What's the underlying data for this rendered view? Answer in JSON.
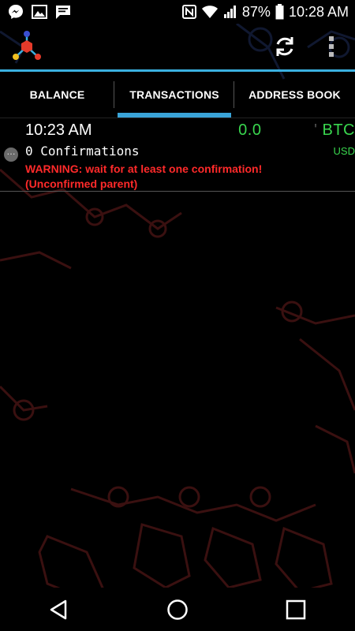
{
  "status_bar": {
    "battery": "87%",
    "time": "10:28 AM",
    "icons": [
      "messenger-icon",
      "image-icon",
      "message-icon",
      "nfc-icon",
      "wifi-icon",
      "signal-icon",
      "battery-icon"
    ]
  },
  "action_bar": {
    "logo": "mycelium-logo-icon",
    "refresh": "refresh-icon",
    "menu": "overflow-menu-icon"
  },
  "tabs": [
    {
      "label": "BALANCE"
    },
    {
      "label": "TRANSACTIONS"
    },
    {
      "label": "ADDRESS BOOK"
    }
  ],
  "transaction": {
    "time": "10:23 AM",
    "amount": "0.0",
    "currency": "BTC",
    "usd": "USD",
    "confirmations": "0 Confirmations",
    "warning_line1": "WARNING: wait for at least one confirmation!",
    "warning_line2": "(Unconfirmed parent)",
    "status_icon": "pending-icon"
  },
  "colors": {
    "accent": "#3ab0e0",
    "amount_green": "#39d64e",
    "warning_red": "#ff2a2a"
  },
  "nav_bar": {
    "back": "back-icon",
    "home": "home-icon",
    "recents": "recents-icon"
  }
}
